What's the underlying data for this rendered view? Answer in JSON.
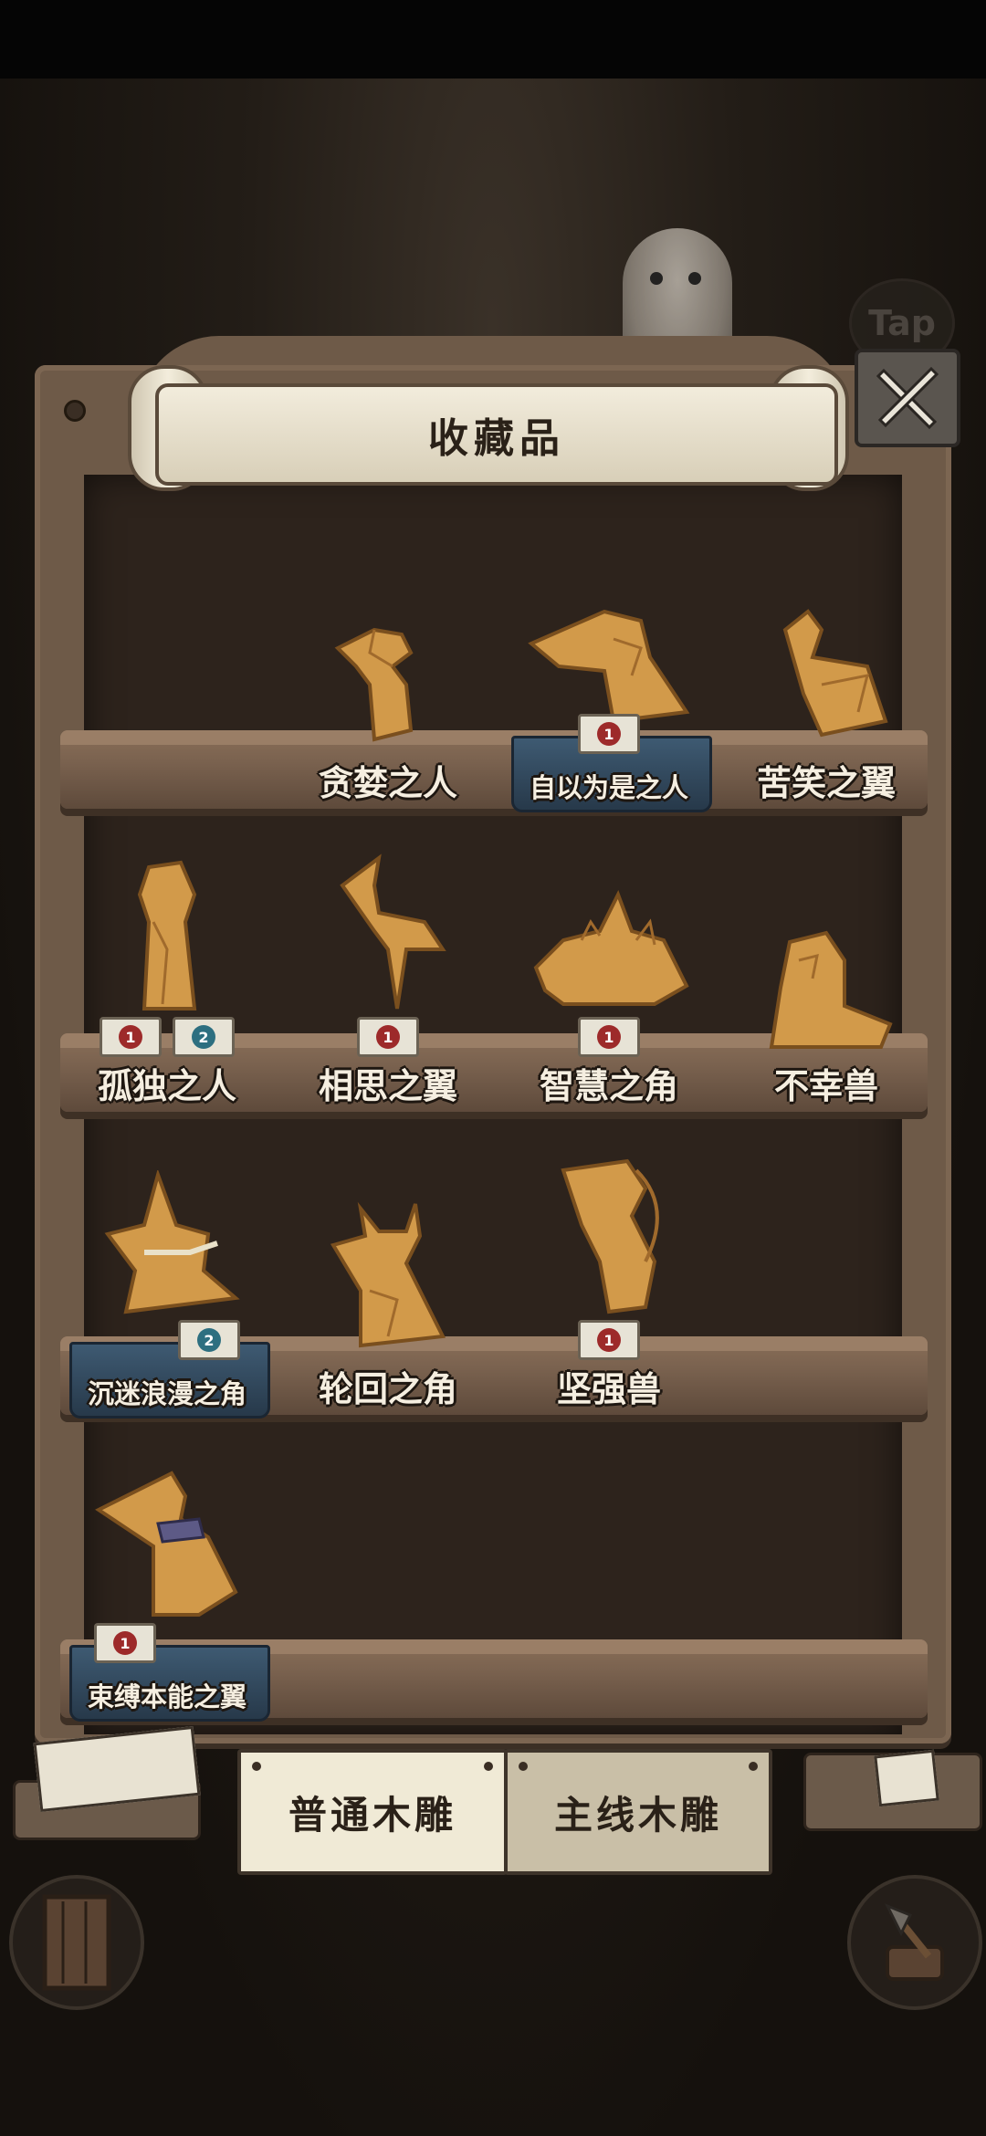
{
  "panel": {
    "title": "收藏品",
    "tap_hint": "Tap"
  },
  "shelves": [
    {
      "items": [
        {
          "name": "贪婪之人",
          "highlighted": false,
          "badges": []
        },
        {
          "name": "自以为是之人",
          "highlighted": true,
          "badges": [
            {
              "color": "red",
              "label": "1"
            }
          ]
        },
        {
          "name": "苦笑之翼",
          "highlighted": false,
          "badges": []
        }
      ]
    },
    {
      "items": [
        {
          "name": "孤独之人",
          "highlighted": false,
          "badges": [
            {
              "color": "red",
              "label": "1"
            },
            {
              "color": "teal",
              "label": "2"
            }
          ]
        },
        {
          "name": "相思之翼",
          "highlighted": false,
          "badges": [
            {
              "color": "red",
              "label": "1"
            }
          ]
        },
        {
          "name": "智慧之角",
          "highlighted": false,
          "badges": [
            {
              "color": "red",
              "label": "1"
            }
          ]
        },
        {
          "name": "不幸兽",
          "highlighted": false,
          "badges": []
        }
      ]
    },
    {
      "items": [
        {
          "name": "沉迷浪漫之角",
          "highlighted": true,
          "badges": [
            {
              "color": "teal",
              "label": "2"
            }
          ]
        },
        {
          "name": "轮回之角",
          "highlighted": false,
          "badges": []
        },
        {
          "name": "坚强兽",
          "highlighted": false,
          "badges": [
            {
              "color": "red",
              "label": "1"
            }
          ]
        }
      ]
    },
    {
      "items": [
        {
          "name": "束缚本能之翼",
          "highlighted": true,
          "badges": [
            {
              "color": "red",
              "label": "1"
            }
          ]
        }
      ]
    }
  ],
  "tabs": [
    {
      "label": "普通木雕",
      "active": true
    },
    {
      "label": "主线木雕",
      "active": false
    }
  ],
  "colors": {
    "wood_frame": "#6e5a48",
    "shelf": "#7a624f",
    "carving": "#d29a4a",
    "highlight_base": "#2f4559",
    "badge_red": "#9d2a2a",
    "badge_teal": "#2d6f80"
  }
}
